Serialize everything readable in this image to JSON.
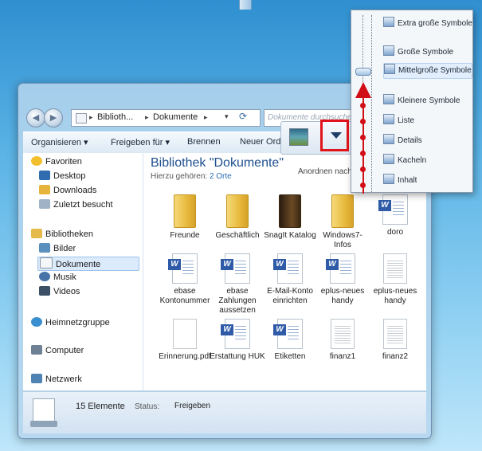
{
  "explorer": {
    "nav": {
      "back_icon": "◀",
      "forward_icon": "▶"
    },
    "address": {
      "segments": [
        "Biblioth...",
        "Dokumente"
      ],
      "separator": "▸",
      "dropdown_icon": "▾",
      "refresh_icon": "⟳"
    },
    "search": {
      "placeholder": "Dokumente durchsuchen"
    },
    "toolbar": {
      "organize": "Organisieren ▾",
      "share": "Freigeben für ▾",
      "burn": "Brennen",
      "new_folder": "Neuer Ordner"
    },
    "sidebar": {
      "favorites": "Favoriten",
      "desktop": "Desktop",
      "downloads": "Downloads",
      "recent": "Zuletzt besucht",
      "libraries": "Bibliotheken",
      "pictures": "Bilder",
      "documents": "Dokumente",
      "music": "Musik",
      "videos": "Videos",
      "homegroup": "Heimnetzgruppe",
      "computer": "Computer",
      "network": "Netzwerk"
    },
    "library": {
      "title": "Bibliothek \"Dokumente\"",
      "includes_label": "Hierzu gehören:",
      "includes_link": "2 Orte",
      "arrange": "Anordnen nach:"
    },
    "files": [
      {
        "name": "Freunde",
        "type": "folder"
      },
      {
        "name": "Geschäftlich",
        "type": "folder"
      },
      {
        "name": "SnagIt Katalog",
        "type": "folder-dark"
      },
      {
        "name": "Windows7-Infos",
        "type": "folder"
      },
      {
        "name": "doro",
        "type": "word"
      },
      {
        "name": "ebase Kontonummer",
        "type": "word"
      },
      {
        "name": "ebase Zahlungen aussetzen",
        "type": "word"
      },
      {
        "name": "E-Mail-Konto einrichten",
        "type": "word"
      },
      {
        "name": "eplus-neues handy",
        "type": "word"
      },
      {
        "name": "eplus-neues handy",
        "type": "document"
      },
      {
        "name": "Erinnerung.pdf",
        "type": "pdf"
      },
      {
        "name": "Erstattung HUK",
        "type": "word"
      },
      {
        "name": "Etiketten",
        "type": "word"
      },
      {
        "name": "finanz1",
        "type": "document"
      },
      {
        "name": "finanz2",
        "type": "document"
      }
    ],
    "status": {
      "count": "15 Elemente",
      "label": "Status:",
      "value": "Freigeben"
    }
  },
  "view_menu": {
    "items": [
      {
        "label": "Extra große Symbole",
        "icon": "extra-large-icons-icon"
      },
      {
        "label": "Große Symbole",
        "icon": "large-icons-icon"
      },
      {
        "label": "Mittelgroße Symbole",
        "icon": "medium-icons-icon"
      },
      {
        "label": "Kleinere Symbole",
        "icon": "small-icons-icon"
      },
      {
        "label": "Liste",
        "icon": "list-icon"
      },
      {
        "label": "Details",
        "icon": "details-icon"
      },
      {
        "label": "Kacheln",
        "icon": "tiles-icon"
      },
      {
        "label": "Inhalt",
        "icon": "content-icon"
      }
    ]
  },
  "colors": {
    "highlight_red": "#e0141a",
    "library_title": "#1e4f8f",
    "link": "#2d6bb3"
  }
}
